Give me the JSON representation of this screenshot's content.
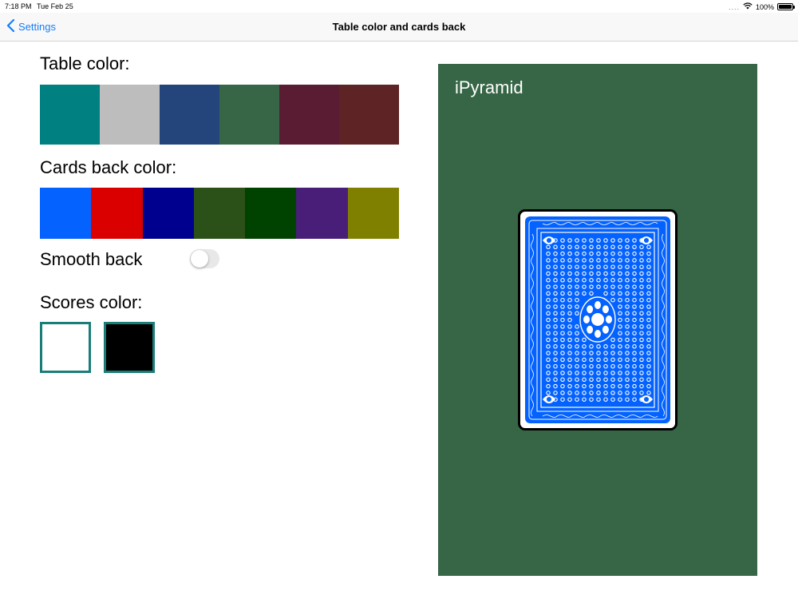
{
  "status_bar": {
    "time": "7:18 PM",
    "date": "Tue Feb 25",
    "signal": "....",
    "battery": "100%",
    "battery_level": 1.0
  },
  "nav": {
    "back_label": "Settings",
    "title": "Table color and cards back"
  },
  "table_color": {
    "label": "Table color:",
    "options": [
      "#008080",
      "#bdbdbd",
      "#23457b",
      "#366645",
      "#5a1c33",
      "#5e2324"
    ]
  },
  "cards_back_color": {
    "label": "Cards back color:",
    "options": [
      "#0462ff",
      "#db0000",
      "#00008e",
      "#2b5018",
      "#004200",
      "#491e79",
      "#808000"
    ]
  },
  "smooth_back": {
    "label": "Smooth back",
    "enabled": false
  },
  "scores_color": {
    "label": "Scores color:",
    "options": [
      "#ffffff",
      "#000000"
    ],
    "border_color": "#1a7d78"
  },
  "preview": {
    "app_name": "iPyramid",
    "table_color": "#366645",
    "card_back_color": "#0462ff"
  }
}
